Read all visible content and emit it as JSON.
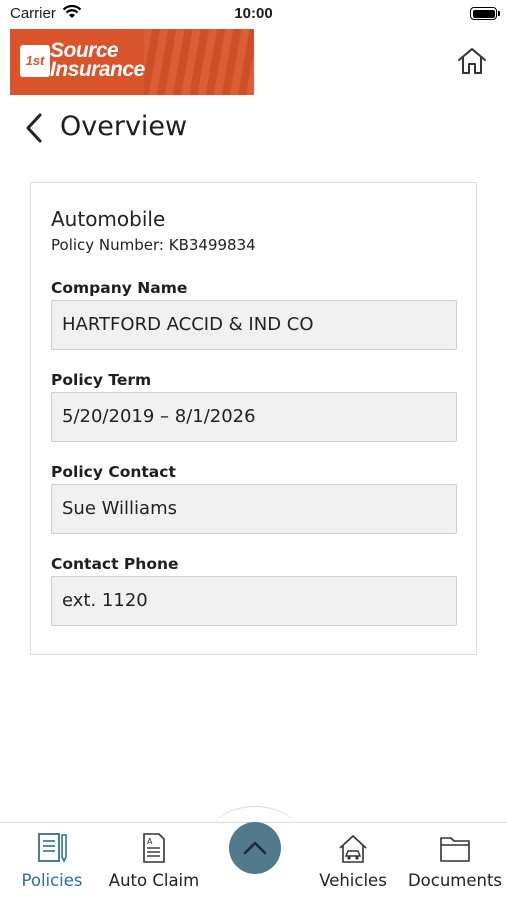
{
  "status_bar": {
    "carrier": "Carrier",
    "time": "10:00"
  },
  "header": {
    "logo_line1": "Source",
    "logo_line2": "Insurance",
    "logo_mark": "1st"
  },
  "page": {
    "title": "Overview"
  },
  "policy": {
    "type": "Automobile",
    "policy_number": "Policy Number: KB3499834",
    "fields": [
      {
        "label": "Company Name",
        "value": "HARTFORD ACCID & IND CO"
      },
      {
        "label": "Policy Term",
        "value": "5/20/2019 – 8/1/2026"
      },
      {
        "label": "Policy Contact",
        "value": "Sue Williams"
      },
      {
        "label": "Contact Phone",
        "value": "ext. 1120"
      }
    ]
  },
  "nav": {
    "items": [
      {
        "label": "Policies",
        "icon": "policies-icon",
        "active": true
      },
      {
        "label": "Auto Claim",
        "icon": "auto-claim-icon",
        "active": false
      },
      {
        "label": "Vehicles",
        "icon": "vehicles-icon",
        "active": false
      },
      {
        "label": "Documents",
        "icon": "documents-icon",
        "active": false
      }
    ],
    "center_button_icon": "chevron-up-icon"
  },
  "colors": {
    "brand": "#d9542a",
    "accent": "#2f6f9c",
    "fab": "#517a8c"
  }
}
